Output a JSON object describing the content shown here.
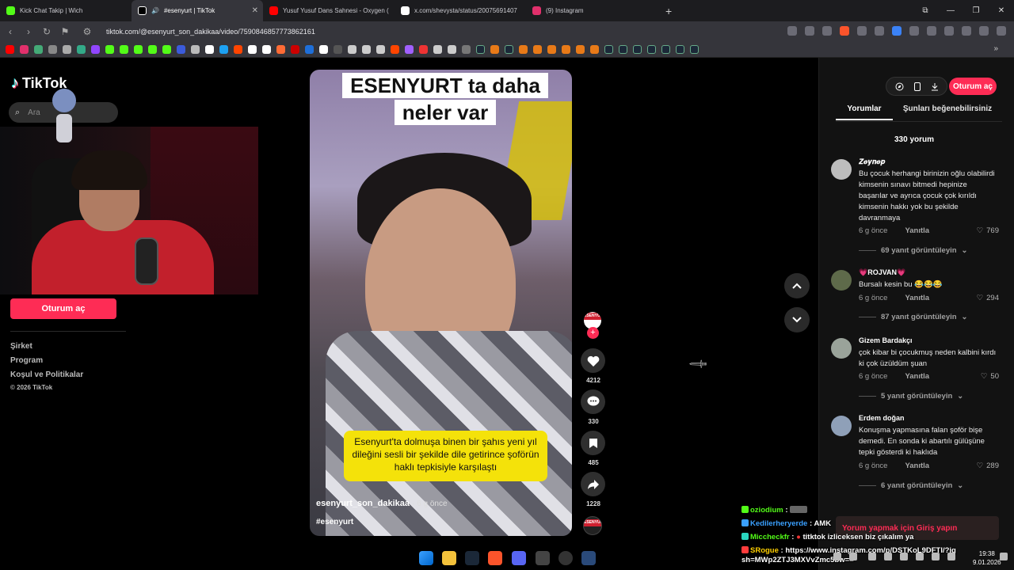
{
  "browser": {
    "tabs": [
      {
        "title": "Kick Chat Takip | Wich",
        "fav_color": "#53fc18"
      },
      {
        "title": "#esenyurt | TikTok",
        "fav_color": "#ffffff",
        "active": true
      },
      {
        "title": "Yusuf Yusuf Dans Sahnesi - Oxygen (",
        "fav_color": "#ff0000"
      },
      {
        "title": "x.com/shevysta/status/20075691407",
        "fav_color": "#ffffff"
      },
      {
        "title": "(9) Instagram",
        "fav_color": "#e1306c"
      }
    ],
    "url": "tiktok.com/@esenyurt_son_dakikaa/video/7590846857773862161"
  },
  "sidebar": {
    "logo": "TikTok",
    "search_placeholder": "Ara",
    "login_label": "Oturum aç",
    "links": [
      "Şirket",
      "Program",
      "Koşul ve Politikalar"
    ],
    "copyright": "© 2026 TikTok"
  },
  "video": {
    "title": "ESENYURT ta daha neler var",
    "caption": "Esenyurt'ta dolmuşa binen bir şahıs yeni yıl dileğini sesli bir şekilde dile getirince şoförün haklı tepkisiyle karşılaştı",
    "username": "esenyurt_son_dakikaa",
    "when": "· 6 g önce",
    "hashtag": "#esenyurt",
    "avatar_text": "ESENYURT"
  },
  "actions": {
    "likes": "4212",
    "comments": "330",
    "saves": "485",
    "shares": "1228"
  },
  "panel": {
    "login_label": "Oturum aç",
    "tab_comments": "Yorumlar",
    "tab_liked": "Şunları beğenebilirsiniz",
    "count": "330 yorum",
    "login_prompt": "Yorum yapmak için Giriş yapın",
    "comments": [
      {
        "name": "𝒁𝒆𝒚𝒏𝒆𝒑",
        "text": "Bu çocuk herhangi birinizin oğlu olabilirdi kimsenin sınavı bitmedi hepinize başarılar ve ayrıca çocuk çok kırıldı kimsenin hakkı yok bu şekilde davranmaya",
        "time": "6 g önce",
        "reply": "Yanıtla",
        "likes": "769",
        "view": "69 yanıt görüntüleyin",
        "avatar_color": "#bdbdbd"
      },
      {
        "name": "💗ROJVAN💗",
        "text": "Bursalı kesin bu 😂😂😂",
        "time": "6 g önce",
        "reply": "Yanıtla",
        "likes": "294",
        "view": "87 yanıt görüntüleyin",
        "avatar_color": "#5e6a4a"
      },
      {
        "name": "Gizem Bardakçı",
        "text": "çok kibar bi çocukmuş neden kalbini kırdı ki çok üzüldüm şuan",
        "time": "6 g önce",
        "reply": "Yanıtla",
        "likes": "50",
        "view": "5 yanıt görüntüleyin",
        "avatar_color": "#9aa39a"
      },
      {
        "name": "Erdem doğan",
        "text": "Konuşma yapmasına falan şoför bişe demedi. En sonda ki abartılı gülüşüne tepki gösterdi ki haklıda",
        "time": "6 g önce",
        "reply": "Yanıtla",
        "likes": "289",
        "view": "6 yanıt görüntüleyin",
        "avatar_color": "#8fa0b8"
      }
    ]
  },
  "chat": [
    {
      "user": "oziodium",
      "msg": "",
      "color": "#53fc18",
      "badge": "#53fc18"
    },
    {
      "user": "Kedilerheryerde",
      "msg": "AMK",
      "color": "#3aa0ff",
      "badge": "#3aa0ff"
    },
    {
      "user": "Miccheckfr",
      "msg": "titktok izliceksen biz çıkalım ya",
      "color": "#53fc18",
      "badge": "#2ad6c0"
    },
    {
      "user": "SRogue",
      "msg": "https://www.instagram.com/p/DSTKoL9DFTI/?igsh=MWp2ZTJ3MXVvZmc5bw==",
      "color": "#ffd000",
      "badge": "#ff3c3c"
    }
  ],
  "tray": {
    "time": "19:38",
    "date": "9.01.2026"
  },
  "colors": {
    "accent": "#fe2c55",
    "caption_bg": "#f4e20a"
  }
}
